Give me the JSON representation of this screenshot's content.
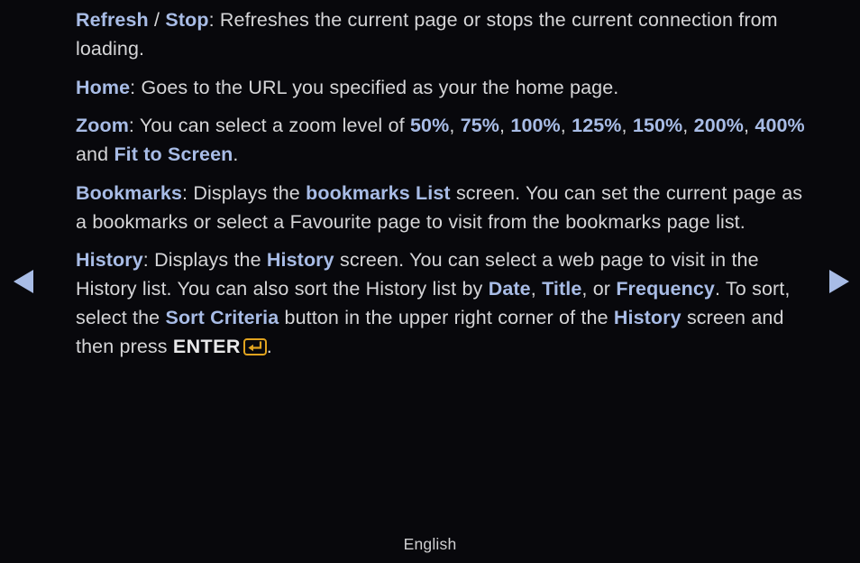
{
  "page": {
    "background_color": "#08080c",
    "body_text_color": "#d5d5d7",
    "keyword_color": "#a8bce6",
    "enter_icon_color": "#e0a31f"
  },
  "paragraphs": [
    {
      "id": "refresh-stop",
      "segments": [
        {
          "type": "keyword",
          "text": "Refresh"
        },
        {
          "type": "plain",
          "text": " / "
        },
        {
          "type": "keyword",
          "text": "Stop"
        },
        {
          "type": "plain",
          "text": ": Refreshes the current page or stops the current connection from loading."
        }
      ]
    },
    {
      "id": "home",
      "segments": [
        {
          "type": "keyword",
          "text": "Home"
        },
        {
          "type": "plain",
          "text": ": Goes to the URL you specified as your the home page."
        }
      ]
    },
    {
      "id": "zoom",
      "segments": [
        {
          "type": "keyword",
          "text": "Zoom"
        },
        {
          "type": "plain",
          "text": ": You can select a zoom level of "
        },
        {
          "type": "keyword",
          "text": "50%"
        },
        {
          "type": "plain",
          "text": ", "
        },
        {
          "type": "keyword",
          "text": "75%"
        },
        {
          "type": "plain",
          "text": ", "
        },
        {
          "type": "keyword",
          "text": "100%"
        },
        {
          "type": "plain",
          "text": ", "
        },
        {
          "type": "keyword",
          "text": "125%"
        },
        {
          "type": "plain",
          "text": ", "
        },
        {
          "type": "keyword",
          "text": "150%"
        },
        {
          "type": "plain",
          "text": ", "
        },
        {
          "type": "keyword",
          "text": "200%"
        },
        {
          "type": "plain",
          "text": ", "
        },
        {
          "type": "keyword",
          "text": "400%"
        },
        {
          "type": "plain",
          "text": " and "
        },
        {
          "type": "keyword",
          "text": "Fit to Screen"
        },
        {
          "type": "plain",
          "text": "."
        }
      ]
    },
    {
      "id": "bookmarks",
      "segments": [
        {
          "type": "keyword",
          "text": "Bookmarks"
        },
        {
          "type": "plain",
          "text": ": Displays the "
        },
        {
          "type": "keyword",
          "text": "bookmarks List"
        },
        {
          "type": "plain",
          "text": " screen. You can set the current page as a bookmarks or select a Favourite page to visit from the bookmarks page list."
        }
      ]
    },
    {
      "id": "history",
      "segments": [
        {
          "type": "keyword",
          "text": "History"
        },
        {
          "type": "plain",
          "text": ": Displays the "
        },
        {
          "type": "keyword",
          "text": "History"
        },
        {
          "type": "plain",
          "text": " screen. You can select a web page to visit in the History list. You can also sort the History list by "
        },
        {
          "type": "keyword",
          "text": "Date"
        },
        {
          "type": "plain",
          "text": ", "
        },
        {
          "type": "keyword",
          "text": "Title"
        },
        {
          "type": "plain",
          "text": ", or "
        },
        {
          "type": "keyword",
          "text": "Frequency"
        },
        {
          "type": "plain",
          "text": ". To sort, select the "
        },
        {
          "type": "keyword",
          "text": "Sort Criteria"
        },
        {
          "type": "plain",
          "text": " button in the upper right corner of the "
        },
        {
          "type": "keyword",
          "text": "History"
        },
        {
          "type": "plain",
          "text": " screen and then press "
        },
        {
          "type": "enter_label",
          "text": "ENTER"
        },
        {
          "type": "enter_icon",
          "text": "enter-key-icon"
        },
        {
          "type": "plain",
          "text": "."
        }
      ]
    }
  ],
  "navigation": {
    "previous_label": "previous-page-arrow",
    "next_label": "next-page-arrow"
  },
  "footer": {
    "language": "English"
  }
}
